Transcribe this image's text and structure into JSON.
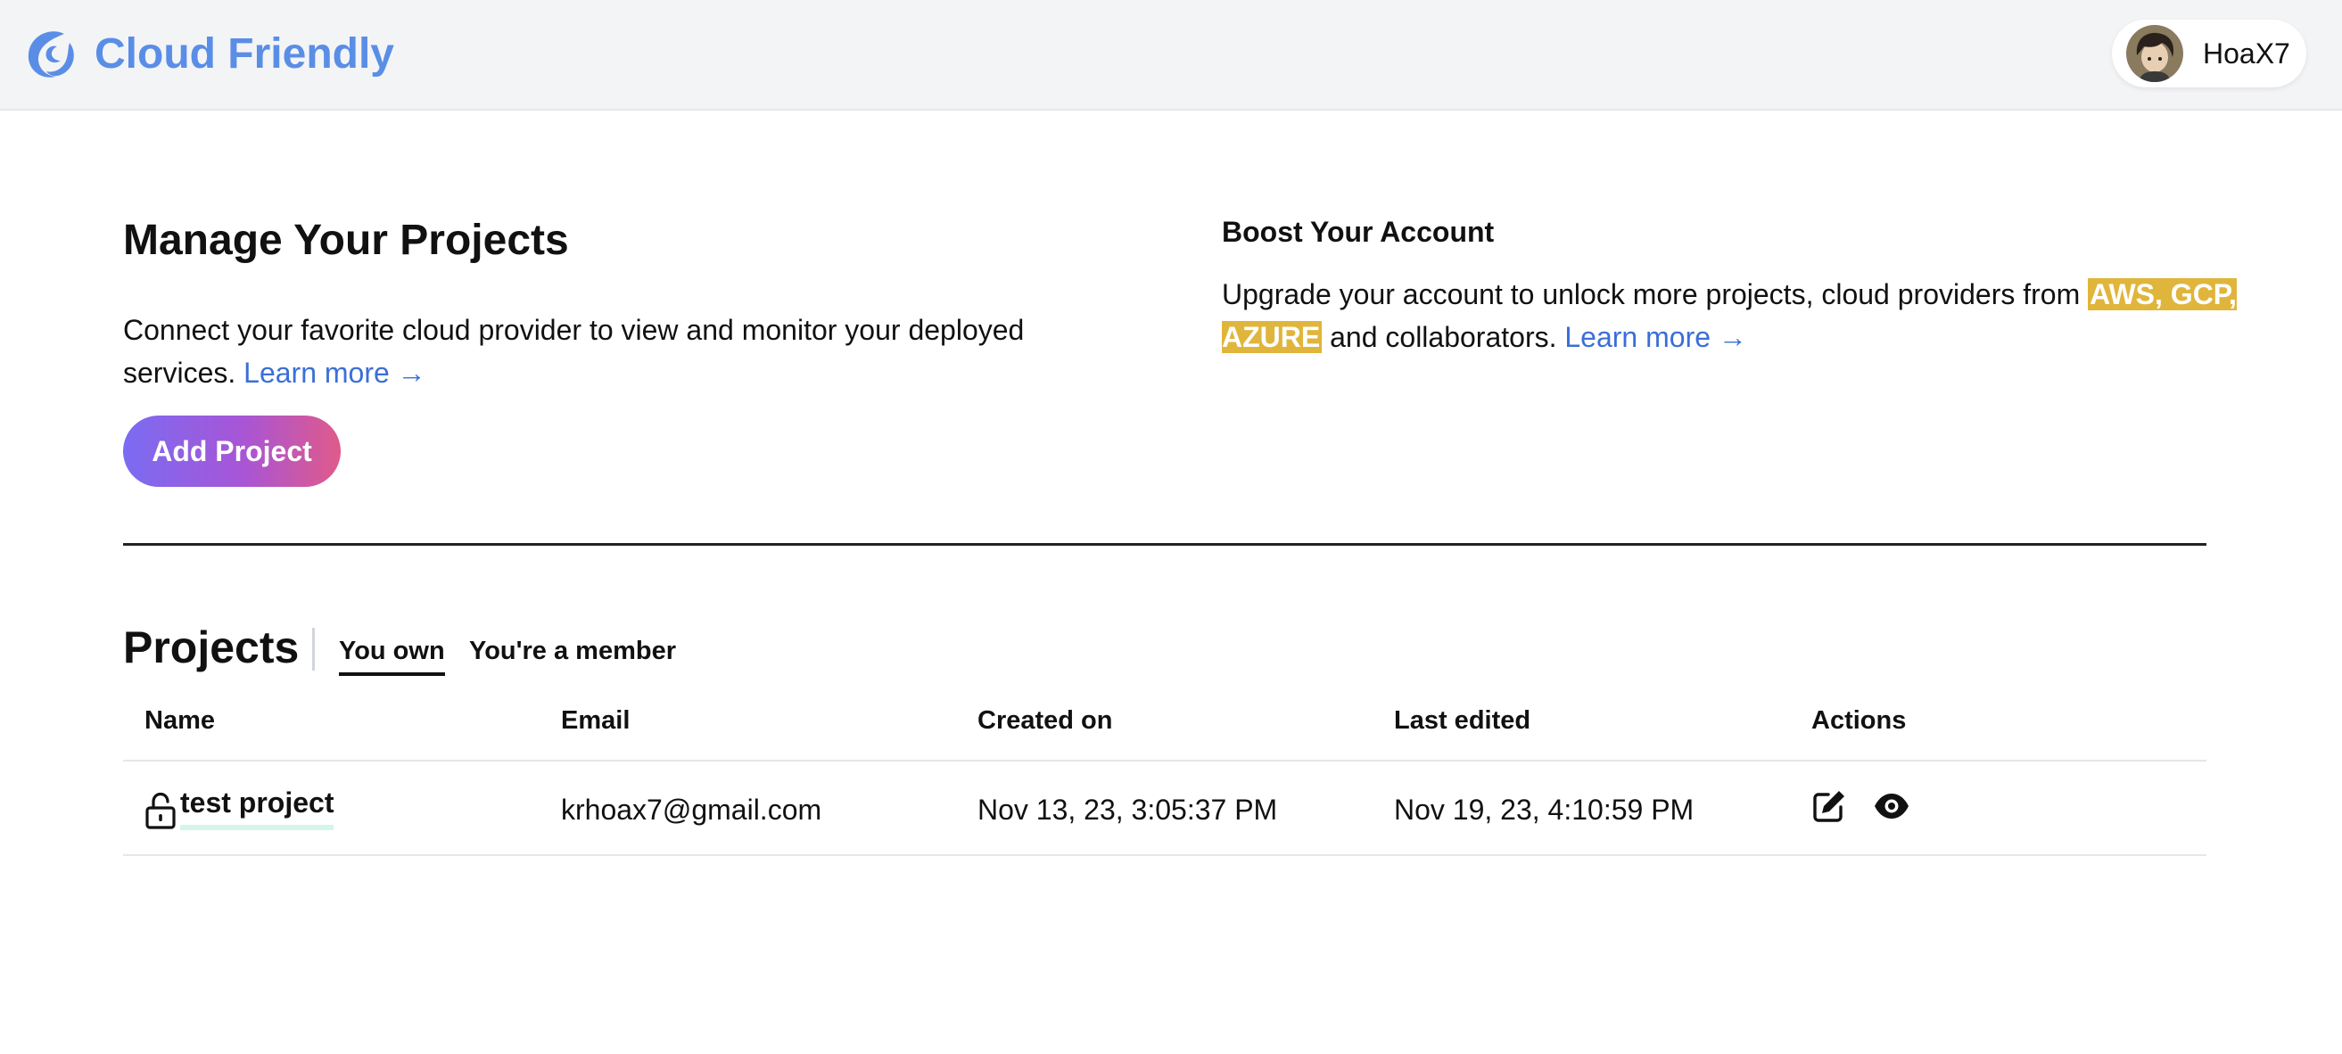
{
  "header": {
    "brand_name": "Cloud Friendly",
    "logo_icon": "cloud-swirl-logo",
    "user": {
      "name": "HoaX7",
      "avatar": "user-avatar"
    }
  },
  "intro": {
    "title": "Manage Your Projects",
    "description": "Connect your favorite cloud provider to view and monitor your deployed services.",
    "learn_more": "Learn more →",
    "add_project_label": "Add Project"
  },
  "boost": {
    "title": "Boost Your Account",
    "description_before": "Upgrade your account to unlock more projects, cloud providers from",
    "highlight": "AWS, GCP, AZURE",
    "description_after": "and collaborators.",
    "learn_more": "Learn more →"
  },
  "projects": {
    "title": "Projects",
    "tabs": [
      {
        "label": "You own",
        "active": true
      },
      {
        "label": "You're a member",
        "active": false
      }
    ],
    "columns": [
      "Name",
      "Email",
      "Created on",
      "Last edited",
      "Actions"
    ],
    "rows": [
      {
        "name": "test project",
        "email": "krhoax7@gmail.com",
        "created_on": "Nov 13, 23, 3:05:37 PM",
        "last_edited": "Nov 19, 23, 4:10:59 PM",
        "icon": "lock-icon",
        "actions": [
          "edit-icon",
          "eye-icon"
        ]
      }
    ]
  },
  "colors": {
    "brand": "#5a8ee6",
    "link": "#3b6fd6",
    "highlight": "#e0b53b",
    "button_gradient": [
      "#7a6cf2",
      "#a855d6",
      "#e05a8a"
    ]
  }
}
